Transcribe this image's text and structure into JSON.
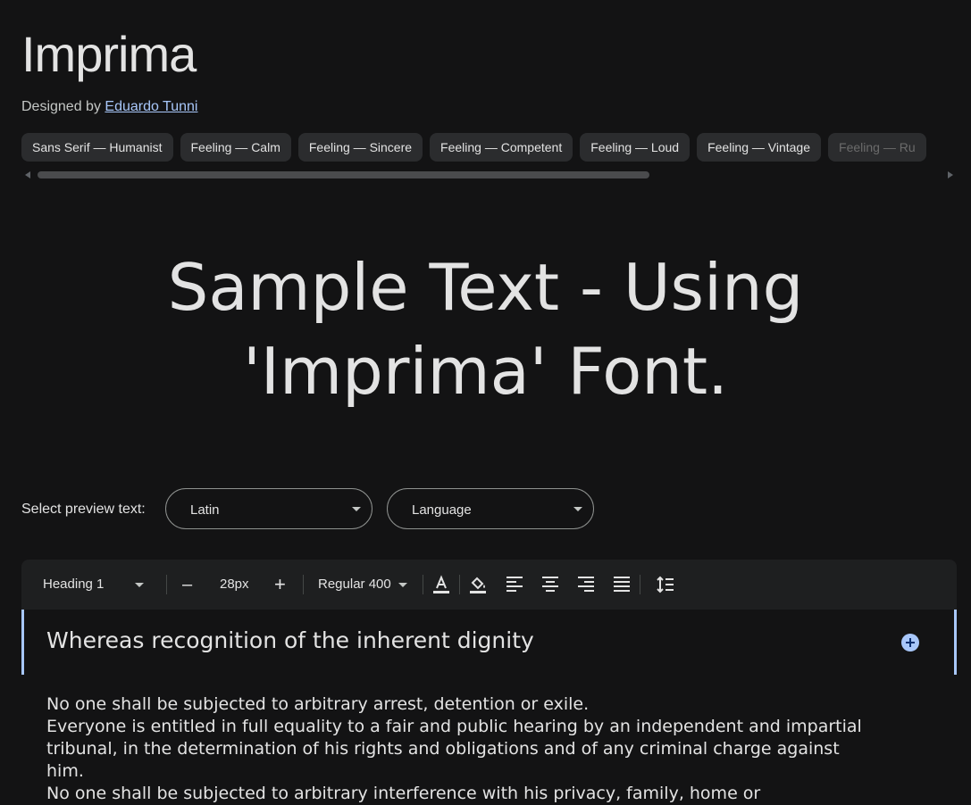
{
  "font": {
    "title": "Imprima",
    "designed_by_label": "Designed by",
    "designer_name": "Eduardo Tunni"
  },
  "tags": [
    "Sans Serif — Humanist",
    "Feeling — Calm",
    "Feeling — Sincere",
    "Feeling — Competent",
    "Feeling — Loud",
    "Feeling — Vintage",
    "Feeling — Ru"
  ],
  "sample": {
    "line1": "Sample Text - Using",
    "line2": "'Imprima' Font."
  },
  "preview": {
    "label": "Select preview text:",
    "script_value": "Latin",
    "language_value": "Language"
  },
  "toolbar": {
    "style_value": "Heading 1",
    "decrease_label": "–",
    "size_value": "28px",
    "increase_label": "+",
    "weight_value": "Regular 400"
  },
  "editor": {
    "heading": "Whereas recognition of the inherent dignity",
    "paragraphs": [
      "No one shall be subjected to arbitrary arrest, detention or exile.",
      "Everyone is entitled in full equality to a fair and public hearing by an independent and impartial tribunal, in the determination of his rights and obligations and of any criminal charge against him.",
      "No one shall be subjected to arbitrary interference with his privacy, family, home or"
    ]
  },
  "colors": {
    "background": "#131314",
    "accent": "#a8c7fa",
    "chip": "#2b2c2e"
  }
}
